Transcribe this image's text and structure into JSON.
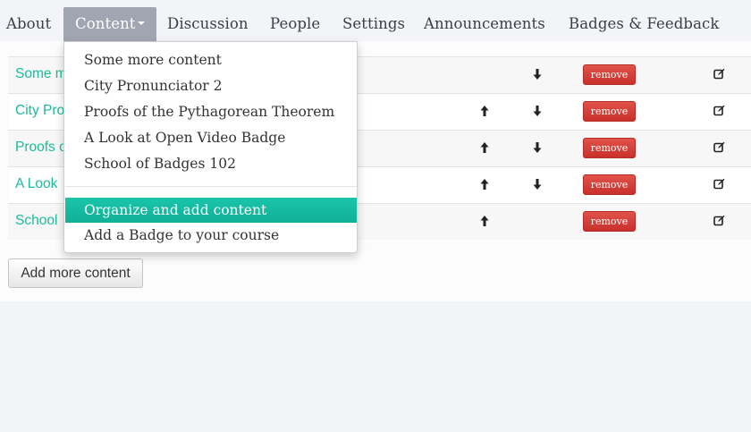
{
  "nav": {
    "items": [
      {
        "label": "About"
      },
      {
        "label": "Content",
        "active": true
      },
      {
        "label": "Discussion"
      },
      {
        "label": "People"
      },
      {
        "label": "Settings"
      },
      {
        "label": "Announcements"
      },
      {
        "label": "Badges & Feedback"
      }
    ]
  },
  "content_table": {
    "rows": [
      {
        "title": "Some m",
        "up": false,
        "down": true,
        "remove_label": "remove"
      },
      {
        "title": "City Pro",
        "up": true,
        "down": true,
        "remove_label": "remove"
      },
      {
        "title": "Proofs o",
        "up": true,
        "down": true,
        "remove_label": "remove"
      },
      {
        "title": "A Look",
        "up": true,
        "down": true,
        "remove_label": "remove"
      },
      {
        "title": "School",
        "up": true,
        "down": false,
        "remove_label": "remove"
      }
    ]
  },
  "add_more_label": "Add more content",
  "dropdown": {
    "content_items": [
      "Some more content",
      "City Pronunciator 2",
      "Proofs of the Pythagorean Theorem",
      "A Look at Open Video Badge",
      "School of Badges 102"
    ],
    "actions": [
      {
        "label": "Organize and add content",
        "highlighted": true
      },
      {
        "label": "Add a Badge to your course",
        "highlighted": false
      }
    ]
  },
  "icons": {
    "up": "arrow-up-icon",
    "down": "arrow-down-icon",
    "edit": "edit-icon",
    "caret": "caret-down-icon"
  },
  "colors": {
    "accent": "#1abc9c",
    "active_tab": "#a1a5b2",
    "remove": "#d9534f"
  }
}
